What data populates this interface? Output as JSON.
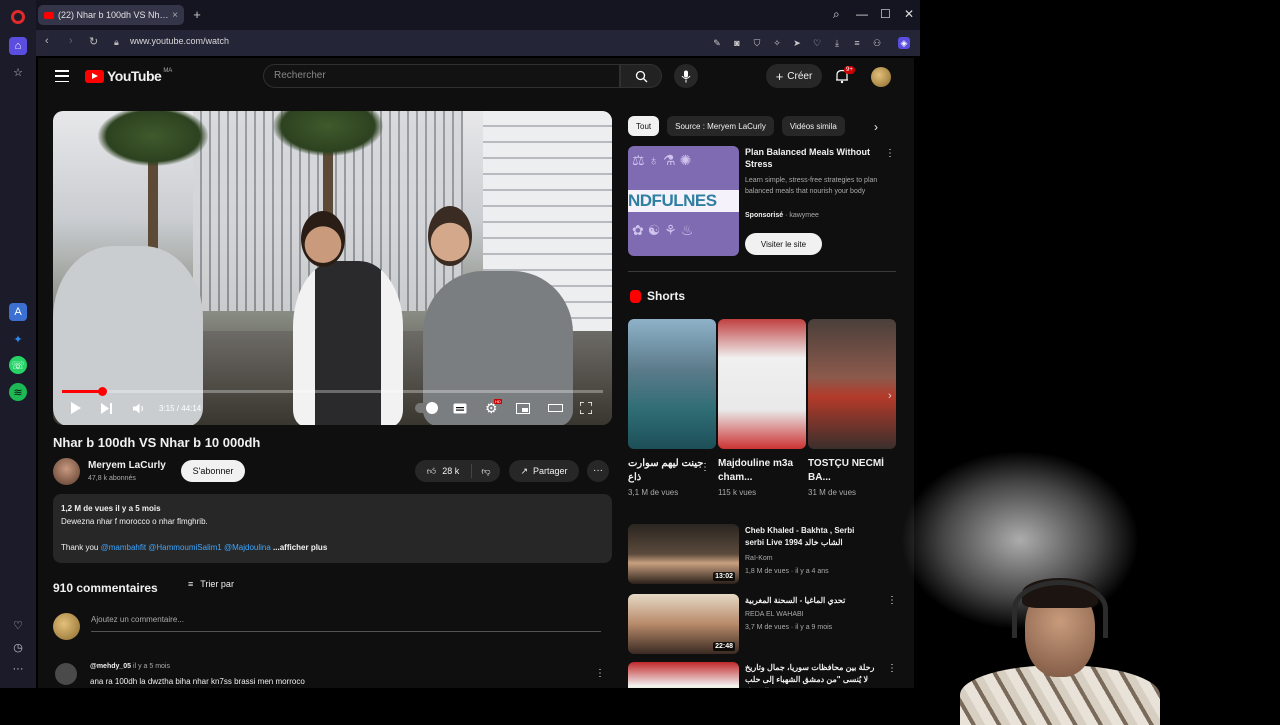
{
  "browser": {
    "tab_title": "(22) Nhar b 100dh VS Nh…",
    "url": "www.youtube.com/watch"
  },
  "masthead": {
    "logo_text": "YouTube",
    "country_code": "MA",
    "search_placeholder": "Rechercher",
    "create_label": "Créer",
    "notification_count": "9+"
  },
  "player": {
    "time": "3:15 / 44:14",
    "progress_fraction": 0.074
  },
  "video": {
    "title": "Nhar b 100dh VS Nhar b 10 000dh",
    "channel": "Meryem LaCurly",
    "subscribers": "47,8 k abonnés",
    "subscribe_label": "S'abonner",
    "likes": "28 k",
    "share_label": "Partager",
    "description": {
      "meta": "1,2 M de vues  il y a 5 mois",
      "line1": "Dewezna nhar f morocco o nhar flmghrib.",
      "thanks": "Thank you",
      "mentions": "@mambahfit @HammoumiSalim1 @Majdoulina",
      "more": "...afficher plus"
    }
  },
  "comments": {
    "count_label": "910 commentaires",
    "sort_label": "Trier par",
    "add_placeholder": "Ajoutez un commentaire...",
    "first": {
      "author": "@mehdy_05",
      "when": "il y a 5 mois",
      "text": "ana ra 100dh la dwztha biha nhar kn7ss brassi men morroco"
    }
  },
  "chips": [
    "Tout",
    "Source : Meryem LaCurly",
    "Vidéos simila"
  ],
  "ad": {
    "banner_text": "NDFULNES",
    "title": "Plan Balanced Meals Without Stress",
    "body": "Learn simple, stress-free strategies to plan balanced meals that nourish your body",
    "sponsored": "Sponsorisé",
    "advertiser": "kawymee",
    "cta": "Visiter le site"
  },
  "shorts": {
    "heading": "Shorts",
    "items": [
      {
        "title": "جينت ليهم سوارت ذاع",
        "views": "3,1 M de vues"
      },
      {
        "title": "Majdouline m3a cham...",
        "views": "115 k vues"
      },
      {
        "title": "TOSTÇU NECMİ BA...",
        "views": "31 M de vues"
      }
    ]
  },
  "recommended": [
    {
      "title": "Cheb Khaled - Bakhta , Serbi serbi Live 1994 الشاب خالد",
      "channel": "Raï-Kom",
      "meta": "1,8 M de vues · il y a 4 ans",
      "duration": "13:02"
    },
    {
      "title": "تحدي الماغيا - السحنة المغربية",
      "channel": "REDA EL WAHABI",
      "meta": "3,7 M de vues · il y a 9 mois",
      "duration": "22:48"
    },
    {
      "title": "رحلة بين محافظات سوريا، جمال وتاريخ لا يُنسى \"من دمشق الشهباء إلى حلب الشهباء",
      "channel": "",
      "meta": "",
      "duration": ""
    }
  ],
  "colors": {
    "accent": "#ff0000",
    "link": "#3ea6ff",
    "background": "#0f0f0f",
    "surface": "#272727",
    "opera_home": "#5a4de0"
  }
}
